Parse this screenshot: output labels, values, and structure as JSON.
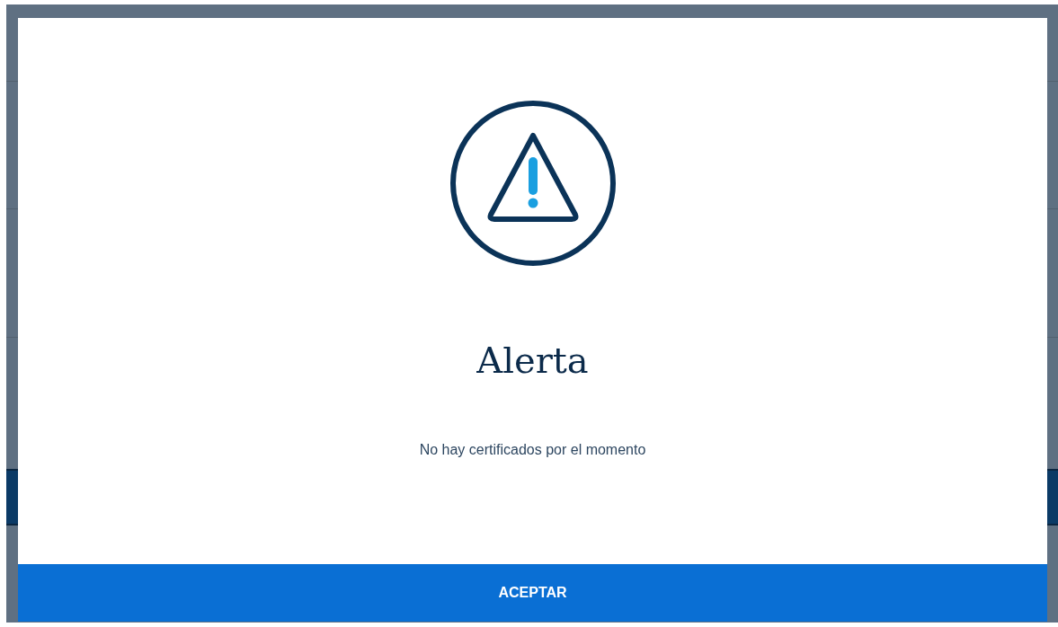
{
  "dialog": {
    "title": "Alerta",
    "message": "No hay certificados por el momento",
    "button": "ACEPTAR"
  }
}
